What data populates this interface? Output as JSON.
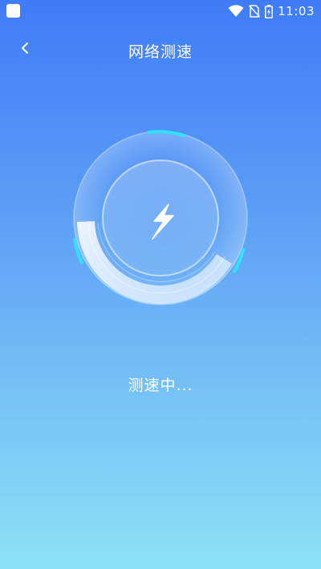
{
  "status_bar": {
    "time": "11:03",
    "icons": [
      "notification-square-icon",
      "wifi-icon",
      "no-sim-icon",
      "battery-icon"
    ]
  },
  "header": {
    "title": "网络测速",
    "back_icon": "chevron-left-icon"
  },
  "speed_test": {
    "status": "测速中...",
    "center_icon": "lightning-bolt-icon"
  },
  "colors": {
    "bg_top": "#3f7cf7",
    "bg_bottom": "#8ce2f6",
    "accent_cyan": "#2fe2f7",
    "text": "#ffffff"
  }
}
